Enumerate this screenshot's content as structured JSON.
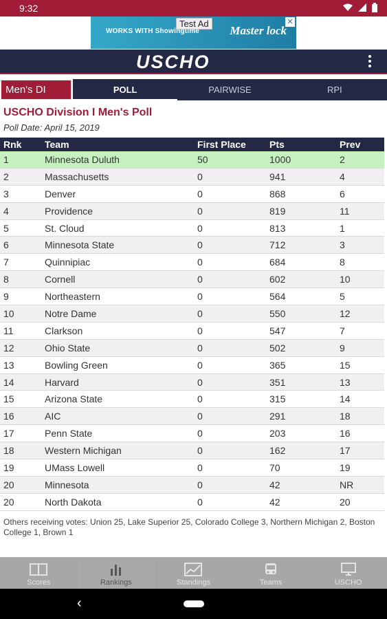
{
  "status": {
    "time": "9:32"
  },
  "ad": {
    "label": "Test Ad",
    "text": "WORKS WITH Showingtime",
    "brand": "Master lock",
    "close": "✕"
  },
  "app": {
    "logo": "USCHO"
  },
  "division": "Men's DI",
  "tabs": [
    {
      "label": "POLL"
    },
    {
      "label": "PAIRWISE"
    },
    {
      "label": "RPI"
    }
  ],
  "poll": {
    "title": "USCHO Division I Men's Poll",
    "date": "Poll Date: April 15, 2019"
  },
  "table": {
    "headers": [
      "Rnk",
      "Team",
      "First Place",
      "Pts",
      "Prev"
    ],
    "rows": [
      [
        "1",
        "Minnesota Duluth",
        "50",
        "1000",
        "2"
      ],
      [
        "2",
        "Massachusetts",
        "0",
        "941",
        "4"
      ],
      [
        "3",
        "Denver",
        "0",
        "868",
        "6"
      ],
      [
        "4",
        "Providence",
        "0",
        "819",
        "11"
      ],
      [
        "5",
        "St. Cloud",
        "0",
        "813",
        "1"
      ],
      [
        "6",
        "Minnesota State",
        "0",
        "712",
        "3"
      ],
      [
        "7",
        "Quinnipiac",
        "0",
        "684",
        "8"
      ],
      [
        "8",
        "Cornell",
        "0",
        "602",
        "10"
      ],
      [
        "9",
        "Northeastern",
        "0",
        "564",
        "5"
      ],
      [
        "10",
        "Notre Dame",
        "0",
        "550",
        "12"
      ],
      [
        "11",
        "Clarkson",
        "0",
        "547",
        "7"
      ],
      [
        "12",
        "Ohio State",
        "0",
        "502",
        "9"
      ],
      [
        "13",
        "Bowling Green",
        "0",
        "365",
        "15"
      ],
      [
        "14",
        "Harvard",
        "0",
        "351",
        "13"
      ],
      [
        "15",
        "Arizona State",
        "0",
        "315",
        "14"
      ],
      [
        "16",
        "AIC",
        "0",
        "291",
        "18"
      ],
      [
        "17",
        "Penn State",
        "0",
        "203",
        "16"
      ],
      [
        "18",
        "Western Michigan",
        "0",
        "162",
        "17"
      ],
      [
        "19",
        "UMass Lowell",
        "0",
        "70",
        "19"
      ],
      [
        "20",
        "Minnesota",
        "0",
        "42",
        "NR"
      ],
      [
        "20",
        "North Dakota",
        "0",
        "42",
        "20"
      ]
    ]
  },
  "others": "Others receiving votes: Union 25, Lake Superior 25, Colorado College 3, Northern Michigan 2, Boston College 1, Brown 1",
  "bottom_nav": [
    {
      "label": "Scores",
      "icon": "scoreboard-icon"
    },
    {
      "label": "Rankings",
      "icon": "bar-chart-icon"
    },
    {
      "label": "Standings",
      "icon": "line-chart-icon"
    },
    {
      "label": "Teams",
      "icon": "bus-icon"
    },
    {
      "label": "USCHO",
      "icon": "monitor-icon"
    }
  ],
  "colors": {
    "brand_red": "#a01c37",
    "navy": "#232944",
    "highlight_green": "#c6f0c0"
  }
}
